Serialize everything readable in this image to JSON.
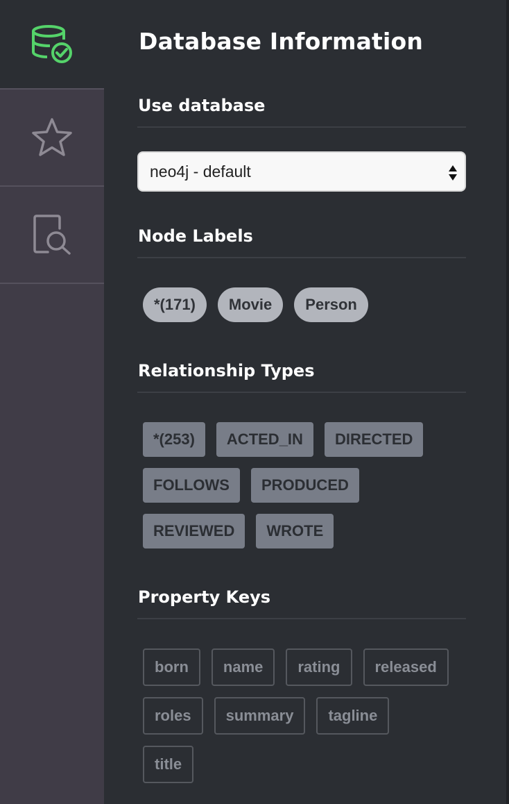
{
  "sidebar": {
    "items": [
      {
        "name": "database-icon",
        "active": true,
        "color": "#55d36a"
      },
      {
        "name": "star-icon",
        "active": false
      },
      {
        "name": "document-search-icon",
        "active": false
      }
    ]
  },
  "drawer": {
    "title": "Database Information"
  },
  "use_database": {
    "title": "Use database",
    "selected": "neo4j - default"
  },
  "node_labels": {
    "title": "Node Labels",
    "items": [
      "*(171)",
      "Movie",
      "Person"
    ]
  },
  "relationship_types": {
    "title": "Relationship Types",
    "rows": [
      [
        "*(253)",
        "ACTED_IN",
        "DIRECTED"
      ],
      [
        "FOLLOWS",
        "PRODUCED"
      ],
      [
        "REVIEWED",
        "WROTE"
      ]
    ]
  },
  "property_keys": {
    "title": "Property Keys",
    "rows": [
      [
        "born",
        "name",
        "rating",
        "released"
      ],
      [
        "roles",
        "summary",
        "tagline"
      ],
      [
        "title"
      ]
    ]
  },
  "colors": {
    "accent": "#55d36a",
    "background": "#2b2e33",
    "sidebar": "#403c47"
  }
}
